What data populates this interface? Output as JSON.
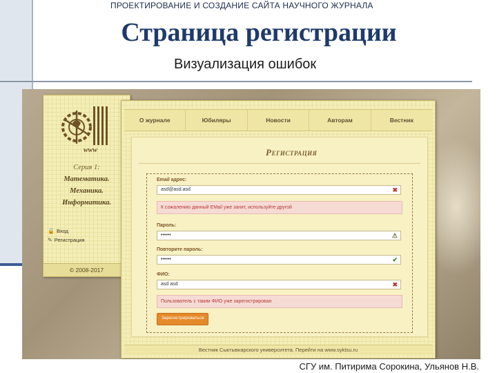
{
  "slide": {
    "top_caption": "ПРОЕКТИРОВАНИЕ И СОЗДАНИЕ САЙТА НАУЧНОГО ЖУРНАЛА",
    "title": "Страница регистрации",
    "subtitle": "Визуализация ошибок",
    "footer": "СГУ им. Питирима Сорокина, Ульянов Н.В."
  },
  "site": {
    "logo_text": "www",
    "series": {
      "line1": "Серия 1:",
      "line2": "Математика.",
      "line3": "Механика.",
      "line4": "Информатика."
    },
    "side_links": [
      {
        "label": "Вход",
        "icon": "lock-icon"
      },
      {
        "label": "Регистрация",
        "icon": "edit-icon"
      }
    ],
    "copyright": "© 2008-2017",
    "nav": [
      "О журнале",
      "Юбиляры",
      "Новости",
      "Авторам",
      "Вестник"
    ],
    "footer": "Вестник Сыктывкарского университета. Перейти на www.syktsu.ru"
  },
  "form": {
    "title": "Регистрация",
    "email_label": "Email адрес:",
    "email_value": "asd@asd.asd",
    "email_icon": "✖",
    "email_error": "К сожалению данный EMail уже занят, используйте другой",
    "password_label": "Пароль:",
    "password_value": "••••••",
    "password_icon": "⚠",
    "password_repeat_label": "Повторите пароль:",
    "password_repeat_value": "••••••",
    "password_repeat_icon": "✔",
    "fio_label": "ФИО:",
    "fio_value": "asd asd",
    "fio_icon": "✖",
    "fio_error": "Пользователь с таким ФИО уже зарегистрирован",
    "submit_label": "Зарегистрироваться"
  },
  "colors": {
    "title": "#1f3a6c",
    "error_text": "#b53a36",
    "error_bg": "#f6dbd5",
    "submit": "#e58a2a"
  }
}
